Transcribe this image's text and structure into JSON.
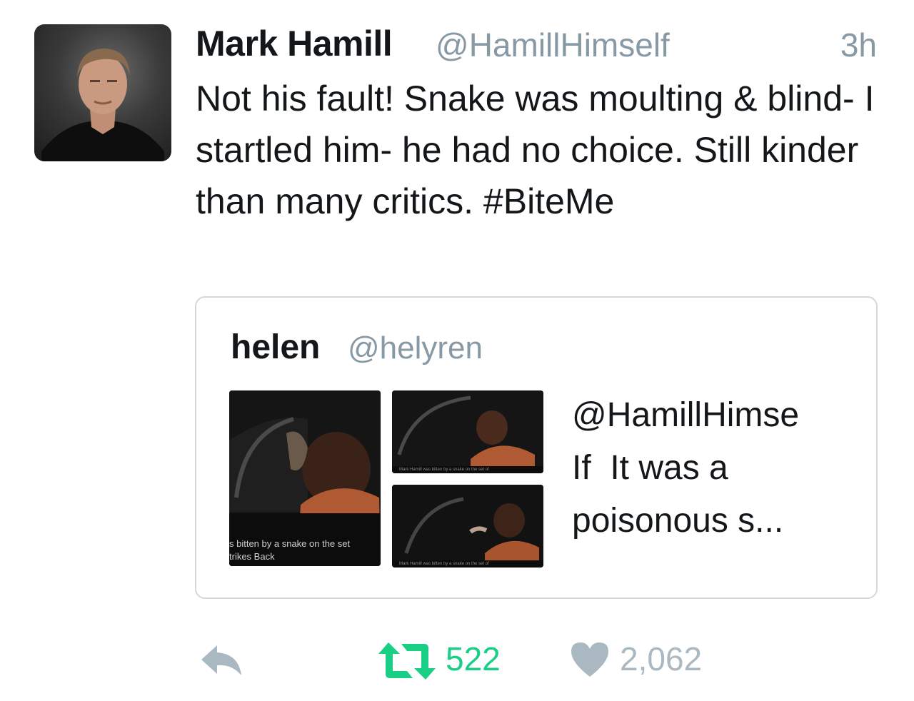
{
  "tweet": {
    "author_name": "Mark Hamill",
    "author_handle": "@HamillHimself",
    "time": "3h",
    "text": "Not his fault! Snake was moulting & blind- I startled him- he had no choice. Still kinder than many critics. #BiteMe"
  },
  "quoted": {
    "author_name": "helen",
    "author_handle": "@helyren",
    "text": "@HamillHimse\nIf  It was a\npoisonous s...",
    "media": [
      {
        "caption": "s bitten by a snake on the set\ntrikes Back"
      },
      {
        "caption": "Mark Hamill was bitten by a snake on the set of"
      },
      {
        "caption": "Mark Hamill was bitten by a snake on the set of"
      }
    ]
  },
  "actions": {
    "retweet_count": "522",
    "like_count": "2,062"
  },
  "colors": {
    "retweet_active": "#19cf86",
    "icon_inactive": "#aab8c2",
    "handle_gray": "#8899a6"
  },
  "icons": [
    "reply-icon",
    "retweet-icon",
    "heart-icon"
  ]
}
